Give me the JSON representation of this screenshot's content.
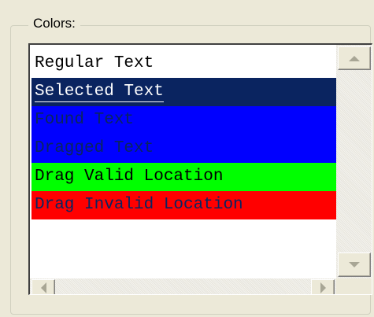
{
  "group": {
    "label": "Colors:"
  },
  "colors_list": {
    "items": [
      {
        "label": "Regular Text",
        "fg": "#000000",
        "bg": "#ffffff"
      },
      {
        "label": "Selected Text",
        "fg": "#ffffff",
        "bg": "#0a2460",
        "selected": true
      },
      {
        "label": "Found Text",
        "fg": "#0a2460",
        "bg": "#0000ff"
      },
      {
        "label": "Dragged Text",
        "fg": "#0a2460",
        "bg": "#0000ff"
      },
      {
        "label": "Drag Valid Location",
        "fg": "#000000",
        "bg": "#00ff00"
      },
      {
        "label": "Drag Invalid Location",
        "fg": "#0a2460",
        "bg": "#ff0000"
      }
    ]
  },
  "scrollbars": {
    "icons": {
      "up": "scroll-up-arrow-icon",
      "down": "scroll-down-arrow-icon",
      "left": "scroll-left-arrow-icon",
      "right": "scroll-right-arrow-icon"
    }
  }
}
